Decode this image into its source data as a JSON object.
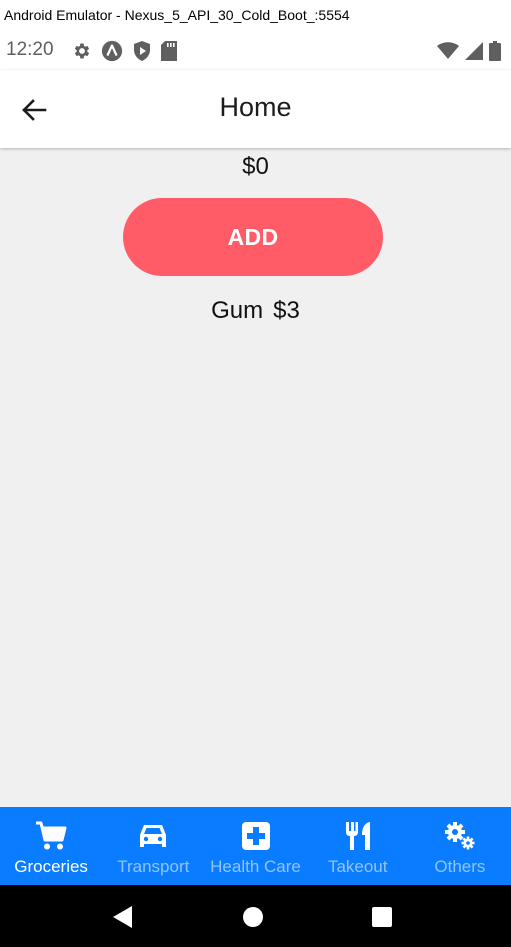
{
  "window": {
    "title": "Android Emulator - Nexus_5_API_30_Cold_Boot_:5554"
  },
  "status_bar": {
    "time": "12:20",
    "left_icons": [
      "settings-icon",
      "app-a-icon",
      "play-protect-icon",
      "sd-card-icon"
    ],
    "right_icons": [
      "wifi-icon",
      "signal-icon",
      "battery-icon"
    ]
  },
  "app_bar": {
    "back_icon": "arrow-back-icon",
    "title": "Home"
  },
  "main": {
    "total": "$0",
    "add_button_label": "ADD",
    "items": [
      {
        "name": "Gum",
        "amount": "$3"
      }
    ]
  },
  "tabs": [
    {
      "label": "Groceries",
      "icon": "cart-icon",
      "active": true
    },
    {
      "label": "Transport",
      "icon": "car-icon",
      "active": false
    },
    {
      "label": "Health Care",
      "icon": "medical-cross-icon",
      "active": false
    },
    {
      "label": "Takeout",
      "icon": "fork-knife-icon",
      "active": false
    },
    {
      "label": "Others",
      "icon": "gears-icon",
      "active": false
    }
  ],
  "colors": {
    "accent": "#0a7cff",
    "add_button": "#ff5c67",
    "content_background": "#f0f0f0"
  },
  "nav_bar": {
    "buttons": [
      "back-triangle-icon",
      "home-circle-icon",
      "recents-square-icon"
    ]
  }
}
